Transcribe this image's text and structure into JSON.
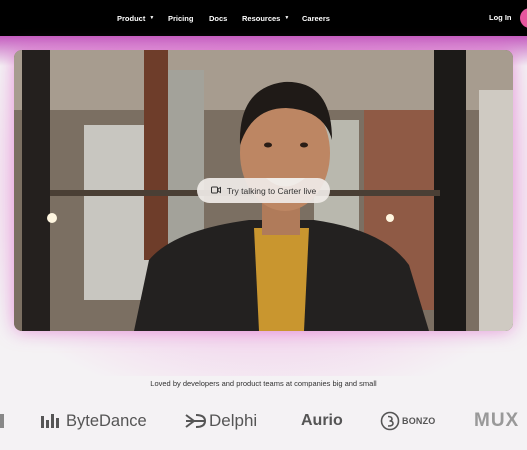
{
  "nav": {
    "items": [
      {
        "label": "Product",
        "has_caret": true
      },
      {
        "label": "Pricing",
        "has_caret": false
      },
      {
        "label": "Docs",
        "has_caret": false
      },
      {
        "label": "Resources",
        "has_caret": true
      },
      {
        "label": "Careers",
        "has_caret": false
      }
    ],
    "login_label": "Log In",
    "caret_icon": "▼"
  },
  "hero": {
    "cta_label": "Try talking to Carter live",
    "cta_icon": "video-camera-icon"
  },
  "trust": {
    "tagline": "Loved by developers and product teams at companies big and small",
    "logos": [
      {
        "name": "ByteDance"
      },
      {
        "name": "Delphi"
      },
      {
        "name": "Aurio"
      },
      {
        "name": "BONZO"
      },
      {
        "name": "MUX"
      }
    ]
  },
  "colors": {
    "nav_bg": "#000000",
    "glow": "#f0a8e0",
    "accent": "#e6559e"
  }
}
